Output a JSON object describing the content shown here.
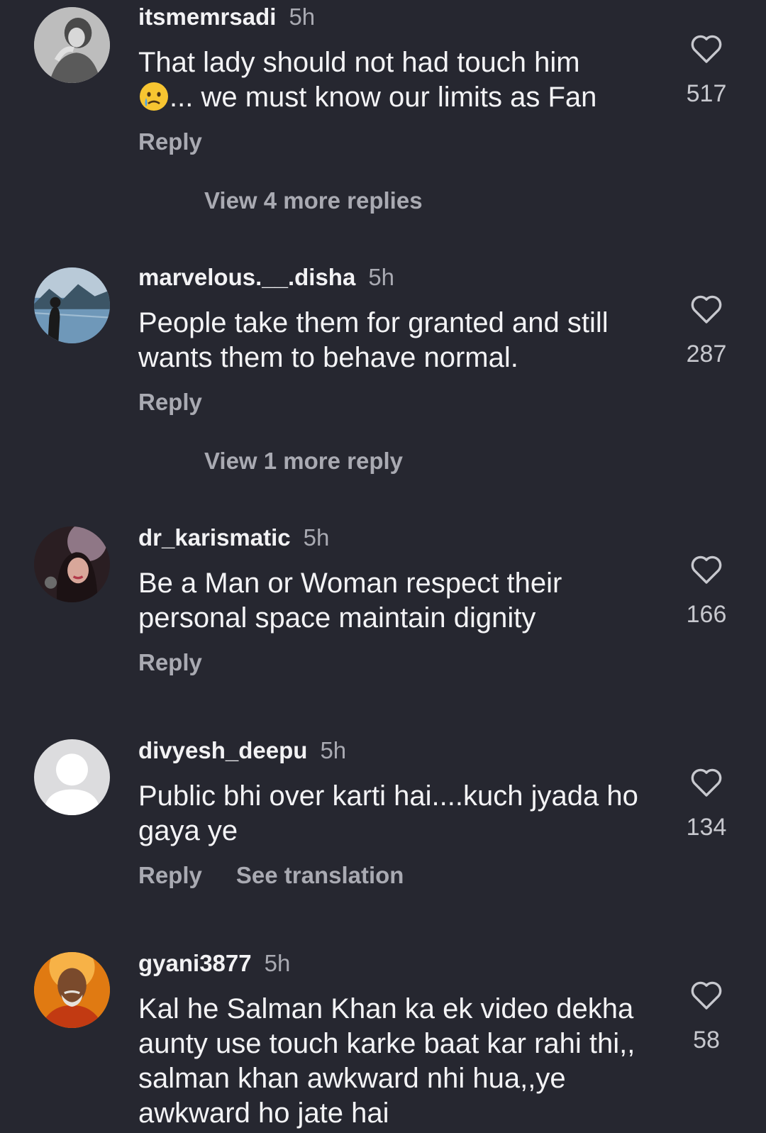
{
  "comments": [
    {
      "username": "itsmemrsadi",
      "time": "5h",
      "text_line1": "That lady should not had touch him",
      "text_line2": "... we must know our limits as Fan",
      "emoji": "crying-face-emoji",
      "likes": "517",
      "reply_label": "Reply",
      "view_more": "View 4 more replies"
    },
    {
      "username": "marvelous.__.disha",
      "time": "5h",
      "text": "People take them for granted and still wants them to behave normal.",
      "likes": "287",
      "reply_label": "Reply",
      "view_more": "View 1 more reply"
    },
    {
      "username": "dr_karismatic",
      "time": "5h",
      "text": "Be a Man or Woman respect their personal space maintain dignity",
      "likes": "166",
      "reply_label": "Reply"
    },
    {
      "username": "divyesh_deepu",
      "time": "5h",
      "text": "Public bhi over karti hai....kuch jyada ho gaya ye",
      "likes": "134",
      "reply_label": "Reply",
      "translate_label": "See translation"
    },
    {
      "username": "gyani3877",
      "time": "5h",
      "text": "Kal he Salman Khan ka ek video dekha aunty use touch karke baat kar rahi thi,, salman khan awkward nhi hua,,ye awkward ho jate hai",
      "likes": "58"
    }
  ],
  "icons": {
    "like": "heart-outline-icon"
  },
  "colors": {
    "background": "#262730",
    "text": "#f2f2f4",
    "secondary": "#a9aab2"
  }
}
